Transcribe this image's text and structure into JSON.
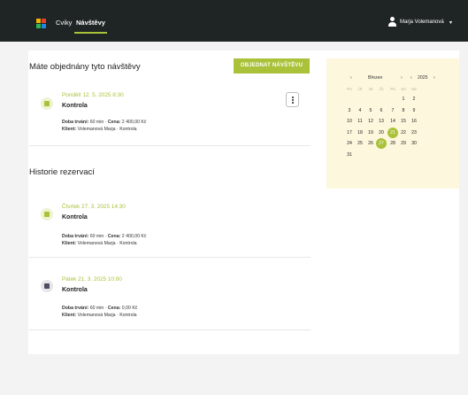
{
  "nav": {
    "items": [
      {
        "label": "Cviky"
      },
      {
        "label": "Návštěvy"
      }
    ],
    "user_name": "Marja Volemanová",
    "caret": "▾"
  },
  "upcoming": {
    "title": "Máte objednány tyto návštěvy",
    "order_button": "OBJEDNAT NÁVŠTĚVU",
    "cards": [
      {
        "date": "Pondělí 12. 5. 2025 8:30",
        "name": "Kontrola",
        "duration_label": "Doba trvání:",
        "duration": "60 min",
        "price_label": "Cena:",
        "price": "2 400,00 Kč",
        "client_label": "Klient:",
        "client": "Volemanová Marja",
        "type": "Kontrola"
      }
    ]
  },
  "history": {
    "title": "Historie rezervací",
    "cards": [
      {
        "date": "Čtvrtek 27. 3. 2025 14:30",
        "name": "Kontrola",
        "duration_label": "Doba trvání:",
        "duration": "60 min",
        "price_label": "Cena:",
        "price": "2 400,00 Kč",
        "client_label": "Klient:",
        "client": "Volemanová Marja",
        "type": "Kontrola"
      },
      {
        "date": "Pátek 21. 3. 2025 10:00",
        "name": "Kontrola",
        "duration_label": "Doba trvání:",
        "duration": "60 min",
        "price_label": "Cena:",
        "price": "0,00 Kč",
        "client_label": "Klient:",
        "client": "Volemanová Marja",
        "type": "Kontrola"
      }
    ]
  },
  "calendar": {
    "prev_month": "‹",
    "month": "Březen",
    "next_month": "›",
    "prev_year": "‹",
    "year": "2025",
    "next_year": "›",
    "weekdays": [
      "Po",
      "Út",
      "St",
      "Čt",
      "Pá",
      "So",
      "Ne"
    ],
    "weeks": [
      [
        "",
        "",
        "",
        "",
        "",
        "1",
        "2"
      ],
      [
        "3",
        "4",
        "5",
        "6",
        "7",
        "8",
        "9"
      ],
      [
        "10",
        "11",
        "12",
        "13",
        "14",
        "15",
        "16"
      ],
      [
        "17",
        "18",
        "19",
        "20",
        "21",
        "22",
        "23"
      ],
      [
        "24",
        "25",
        "26",
        "27",
        "28",
        "29",
        "30"
      ],
      [
        "31",
        "",
        "",
        "",
        "",
        "",
        ""
      ]
    ],
    "highlighted_days": [
      "21",
      "27"
    ]
  },
  "colors": {
    "accent": "#a9c23a",
    "topbar": "#1f2424",
    "calendar_bg": "#fdf8dd"
  }
}
